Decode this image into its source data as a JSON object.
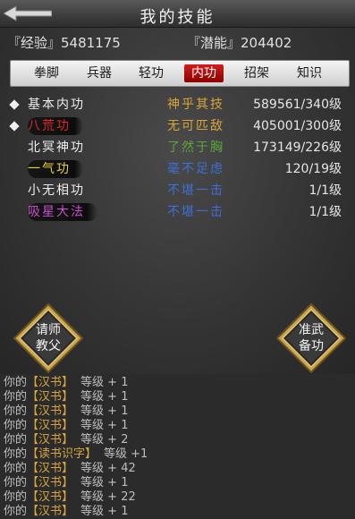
{
  "header": {
    "title": "我的技能"
  },
  "stats": {
    "exp_label": "『经验』",
    "exp_value": "5481175",
    "pot_label": "『潜能』",
    "pot_value": "204402"
  },
  "tabs": [
    {
      "label": "拳脚",
      "active": false
    },
    {
      "label": "兵器",
      "active": false
    },
    {
      "label": "轻功",
      "active": false
    },
    {
      "label": "内功",
      "active": true
    },
    {
      "label": "招架",
      "active": false
    },
    {
      "label": "知识",
      "active": false
    }
  ],
  "skills": [
    {
      "name": "基本内功",
      "rank": "神乎其技",
      "level": "589561/340级",
      "name_color": "#ededed",
      "rank_color": "#d9a53a",
      "marked": true,
      "pill": false
    },
    {
      "name": "八荒功",
      "rank": "无可匹敌",
      "level": "405001/300级",
      "name_color": "#e02a2a",
      "rank_color": "#d9a53a",
      "marked": true,
      "pill": true
    },
    {
      "name": "北冥神功",
      "rank": "了然于胸",
      "level": "173149/226级",
      "name_color": "#ededed",
      "rank_color": "#5aa83a",
      "marked": false,
      "pill": false
    },
    {
      "name": "一气功",
      "rank": "毫不足虑",
      "level": "120/19级",
      "name_color": "#e6d23a",
      "rank_color": "#3f6fd6",
      "marked": false,
      "pill": true
    },
    {
      "name": "小无相功",
      "rank": "不堪一击",
      "level": "1/1级",
      "name_color": "#ededed",
      "rank_color": "#3f6fd6",
      "marked": false,
      "pill": false
    },
    {
      "name": "吸星大法",
      "rank": "不堪一击",
      "level": "1/1级",
      "name_color": "#c84fd0",
      "rank_color": "#3f6fd6",
      "marked": false,
      "pill": true
    }
  ],
  "buttons": {
    "teacher_line1": "请师",
    "teacher_line2": "教父",
    "prepare_line1": "准武",
    "prepare_line2": "备功"
  },
  "log": [
    {
      "prefix": "你的",
      "book": "【汉书】",
      "text": "等级 + 1"
    },
    {
      "prefix": "你的",
      "book": "【汉书】",
      "text": "等级 + 1"
    },
    {
      "prefix": "你的",
      "book": "【汉书】",
      "text": "等级 + 1"
    },
    {
      "prefix": "你的",
      "book": "【汉书】",
      "text": "等级 + 1"
    },
    {
      "prefix": "你的",
      "book": "【汉书】",
      "text": "等级 + 2"
    },
    {
      "prefix": "你的",
      "book": "【读书识字】",
      "text": "等级 +1"
    },
    {
      "prefix": "你的",
      "book": "【汉书】",
      "text": "等级 + 42"
    },
    {
      "prefix": "你的",
      "book": "【汉书】",
      "text": "等级 + 1"
    },
    {
      "prefix": "你的",
      "book": "【汉书】",
      "text": "等级 + 22"
    },
    {
      "prefix": "你的",
      "book": "【汉书】",
      "text": "等级 + 1"
    }
  ],
  "colors": {
    "tab_active": "#c41212",
    "book": "#d6a640"
  }
}
